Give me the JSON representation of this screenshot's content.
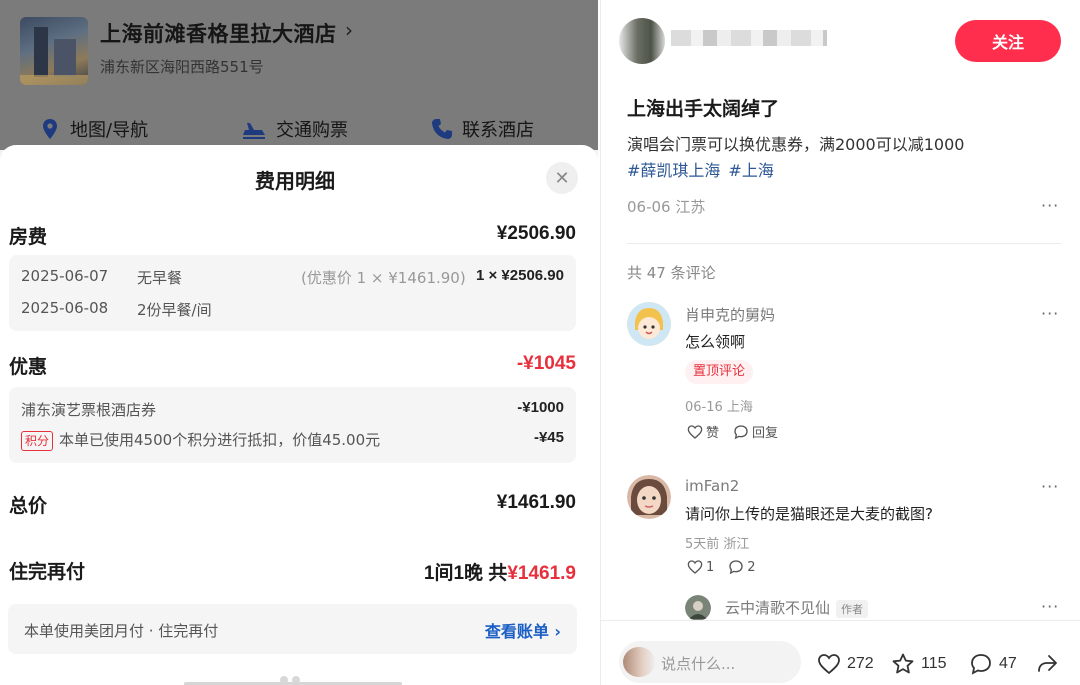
{
  "left": {
    "hotel": {
      "name": "上海前滩香格里拉大酒店",
      "chevron": "›",
      "address": "浦东新区海阳西路551号"
    },
    "quick_links": [
      {
        "icon": "location-pin-icon",
        "label": "地图/导航"
      },
      {
        "icon": "transport-icon",
        "label": "交通购票"
      },
      {
        "icon": "phone-icon",
        "label": "联系酒店"
      }
    ],
    "sheet": {
      "title": "费用明细",
      "close": "✕",
      "room": {
        "label": "房费",
        "amount": "¥2506.90",
        "lines": [
          {
            "date": "2025-06-07",
            "desc": "无早餐",
            "promo": "(优惠价 1 × ¥1461.90)",
            "qty": "1 × ¥2506.90"
          },
          {
            "date": "2025-06-08",
            "desc": "2份早餐/间"
          }
        ]
      },
      "discount": {
        "label": "优惠",
        "amount": "-¥1045",
        "lines": [
          {
            "desc": "浦东演艺票根酒店券",
            "amount": "-¥1000"
          },
          {
            "tag": "积分",
            "desc": "本单已使用4500个积分进行抵扣，价值45.00元",
            "amount": "-¥45"
          }
        ]
      },
      "total": {
        "label": "总价",
        "amount": "¥1461.90"
      },
      "pay_later": {
        "label": "住完再付",
        "prefix": "1间1晚 共",
        "amount": "¥1461.9"
      },
      "payment_note": "本单使用美团月付 · 住完再付",
      "view_bill": "查看账单",
      "view_bill_chevron": "›"
    }
  },
  "right": {
    "follow_label": "关注",
    "post": {
      "title": "上海出手太阔绰了",
      "body": "演唱会门票可以换优惠券，满2000可以减1000",
      "hashtags": [
        "#薛凯琪上海",
        "#上海"
      ],
      "meta": "06-06 江苏",
      "more": "···"
    },
    "comment_count": "共 47 条评论",
    "comments": [
      {
        "name": "肖申克的舅妈",
        "text": "怎么领啊",
        "pin": "置顶评论",
        "meta": "06-16 上海",
        "like": "赞",
        "reply": "回复",
        "more": "···"
      },
      {
        "name": "imFan2",
        "text": "请问你上传的是猫眼还是大麦的截图?",
        "meta": "5天前 浙江",
        "like": "1",
        "reply": "2",
        "more": "···"
      },
      {
        "name": "云中清歌不见仙",
        "badge": "作者",
        "more": "···"
      }
    ],
    "bottom": {
      "placeholder": "说点什么...",
      "likes": "272",
      "stars": "115",
      "comments": "47"
    }
  },
  "colors": {
    "accent_red": "#ff2e4d",
    "price_red": "#e8303c",
    "link_blue": "#1b5fc4",
    "hashtag_blue": "#2d5796"
  }
}
